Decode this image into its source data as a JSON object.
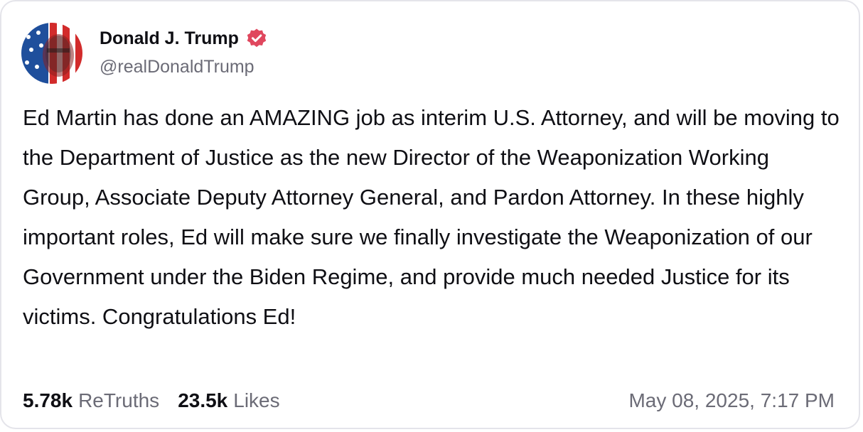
{
  "author": {
    "display_name": "Donald J. Trump",
    "handle": "@realDonaldTrump",
    "avatar_icon": "avatar-image",
    "verified_icon": "verified-badge-icon",
    "verified_color": "#e0475e"
  },
  "post": {
    "text": "Ed Martin has done an AMAZING job as interim U.S. Attorney, and will be moving to the Department of Justice as the new Director of the Weaponization Working Group, Associate Deputy Attorney General, and Pardon Attorney. In these highly important roles, Ed will make sure we finally investigate the Weaponization of our Government under the Biden Regime, and provide much needed Justice for its victims. Congratulations Ed!"
  },
  "stats": {
    "retruths_count": "5.78k",
    "retruths_label": "ReTruths",
    "likes_count": "23.5k",
    "likes_label": "Likes"
  },
  "timestamp": "May 08, 2025, 7:17 PM"
}
